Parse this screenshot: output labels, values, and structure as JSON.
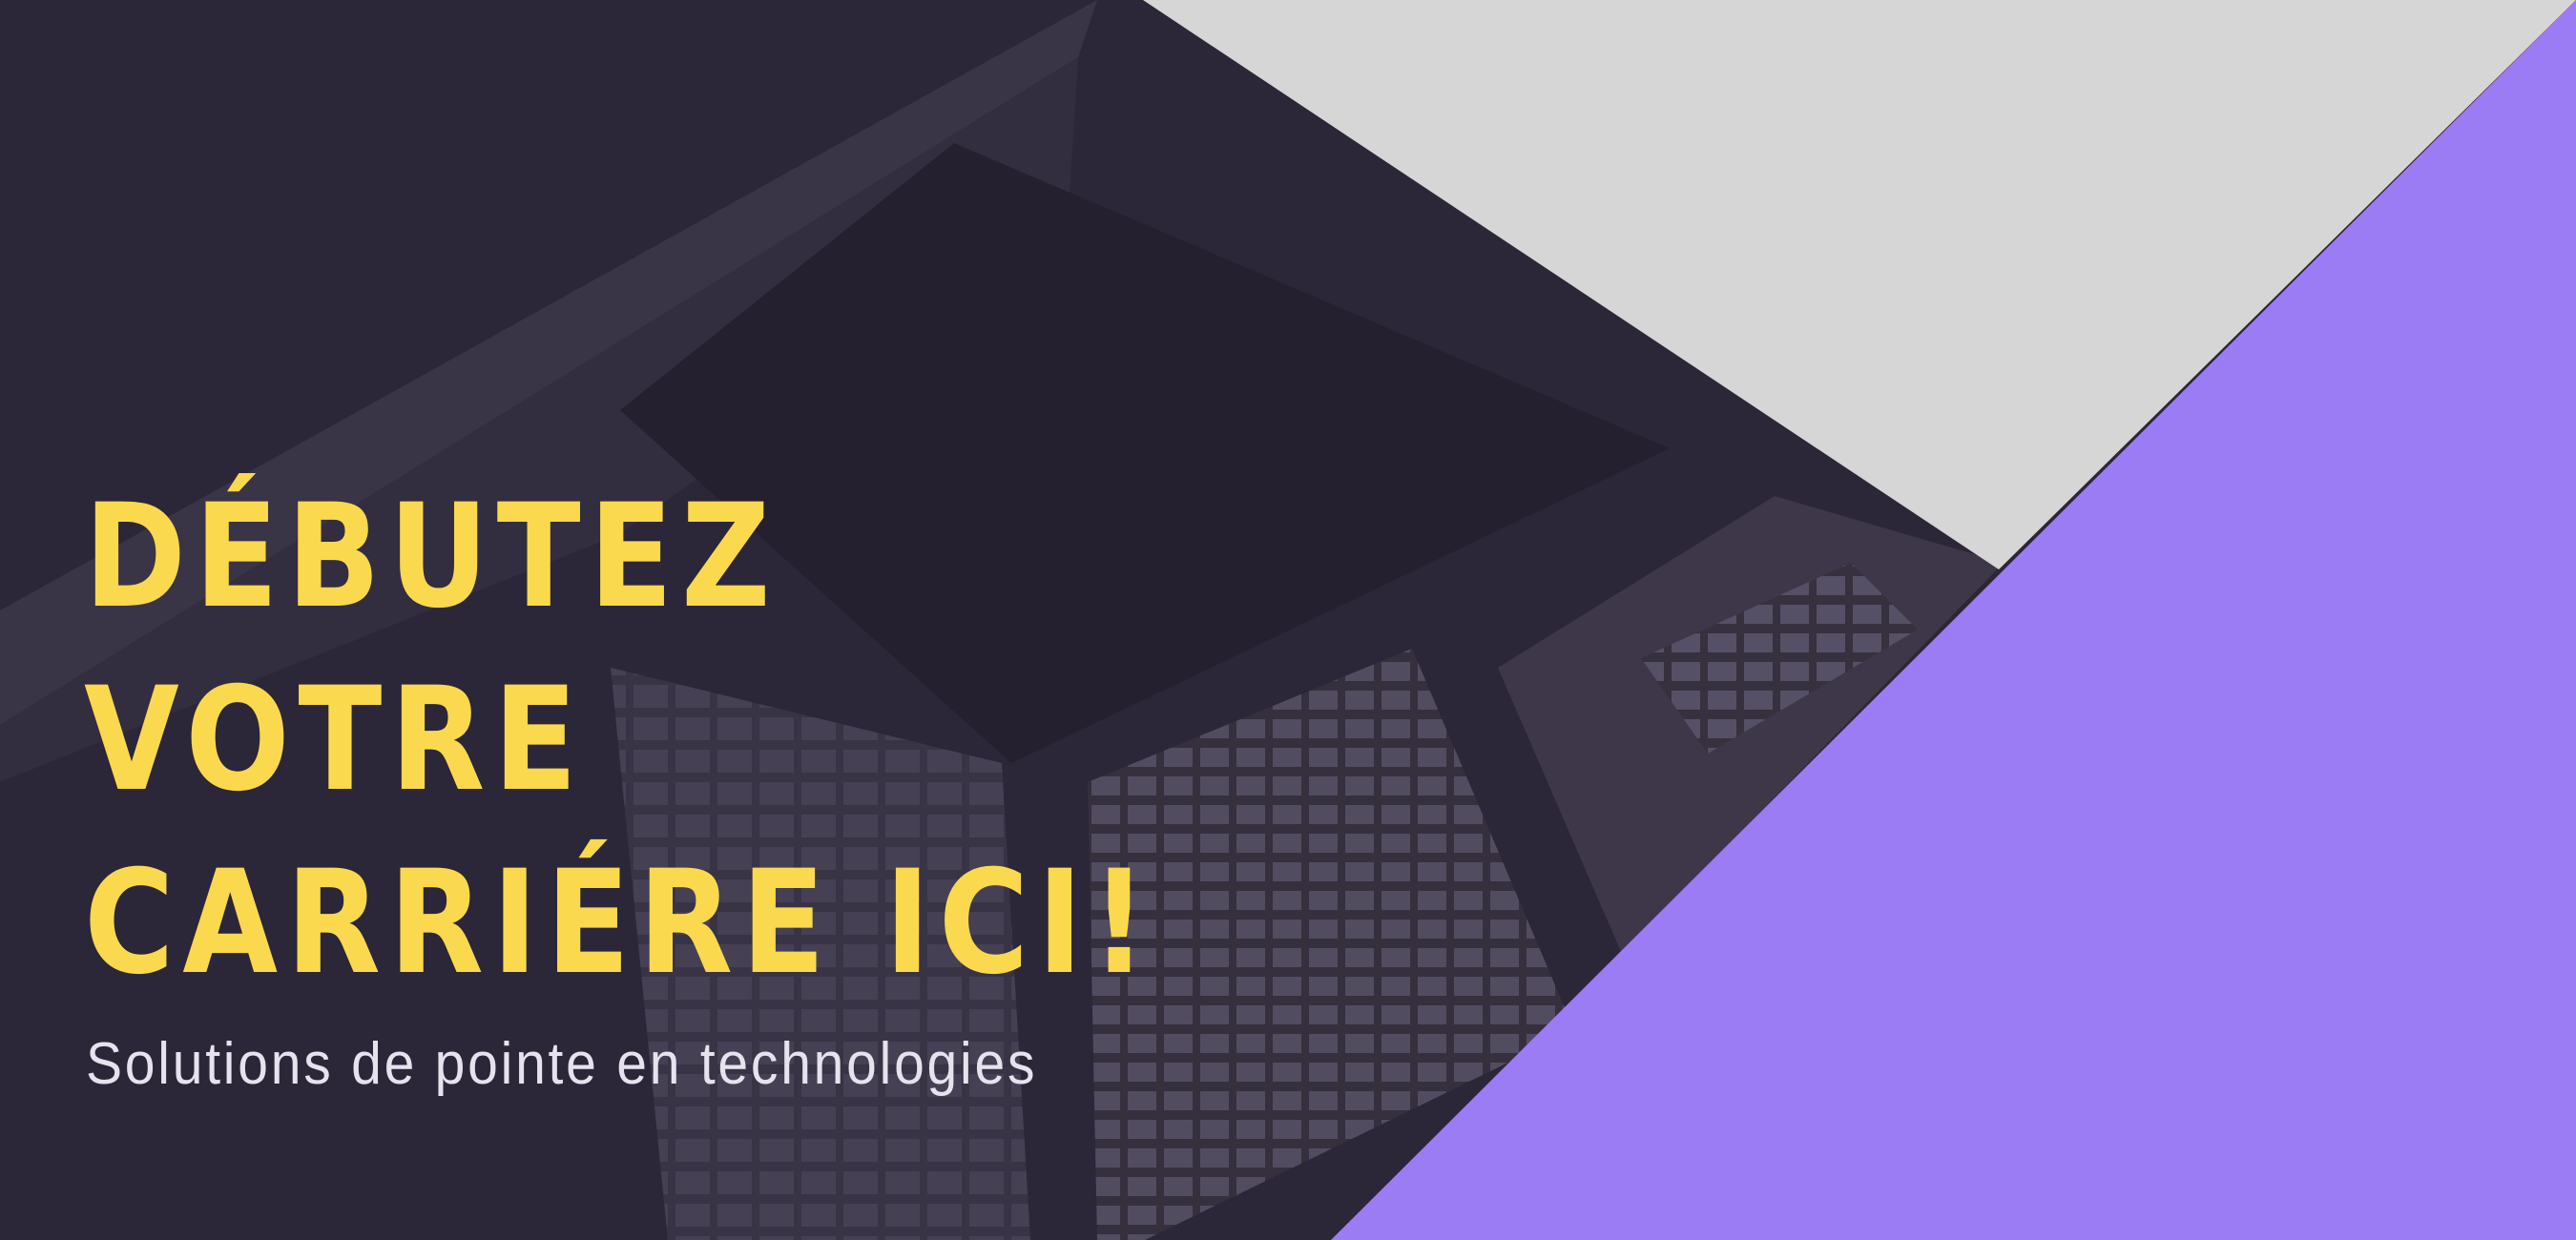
{
  "hero": {
    "headline_lines": [
      "DÉBUTEZ",
      "VOTRE",
      "CARRIÉRE ICI!"
    ],
    "subtitle": "Solutions de pointe en technologies"
  },
  "colors": {
    "background": "#2b2638",
    "accent_purple": "#9b7cf4",
    "headline_yellow": "#fbd94e",
    "light_gray": "#d6d6d6"
  }
}
